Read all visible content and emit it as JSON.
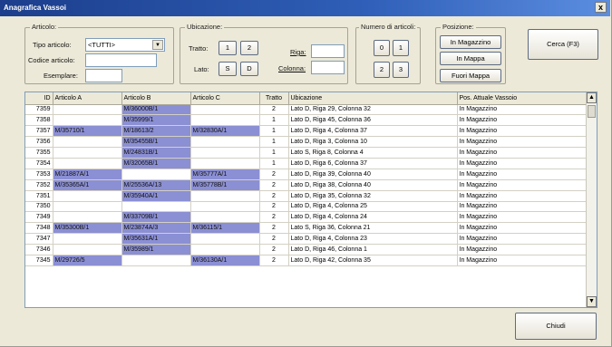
{
  "window": {
    "title": "Anagrafica Vassoi",
    "close": "x"
  },
  "articolo": {
    "title": "Articolo:",
    "tipo_label": "Tipo articolo:",
    "tipo_value": "<TUTTI>",
    "codice_label": "Codice articolo:",
    "codice_value": "",
    "esemplare_label": "Esemplare:",
    "esemplare_value": ""
  },
  "ubicazione": {
    "title": "Ubicazione:",
    "tratto_label": "Tratto:",
    "tratto_buttons": [
      "1",
      "2"
    ],
    "lato_label": "Lato:",
    "lato_buttons": [
      "S",
      "D"
    ],
    "riga_label": "Riga:",
    "riga_value": "",
    "colonna_label": "Colonna:",
    "colonna_value": ""
  },
  "numero": {
    "title": "Numero di articoli:",
    "buttons": [
      "0",
      "1",
      "2",
      "3"
    ]
  },
  "posizione": {
    "title": "Posizione:",
    "buttons": [
      "In Magazzino",
      "In Mappa",
      "Fuori Mappa"
    ]
  },
  "search_button": "Cerca (F3)",
  "close_button": "Chiudi",
  "table": {
    "headers": [
      "ID",
      "Articolo A",
      "Articolo B",
      "Articolo C",
      "Tratto",
      "Ubicazione",
      "Pos. Attuale Vassoio"
    ],
    "rows": [
      [
        "7359",
        "",
        "M/36000B/1",
        "",
        "2",
        "Lato D, Riga 29, Colonna 32",
        "In Magazzino"
      ],
      [
        "7358",
        "",
        "M/35999/1",
        "",
        "1",
        "Lato D, Riga 45, Colonna 36",
        "In Magazzino"
      ],
      [
        "7357",
        "M/35710/1",
        "M/18613/2",
        "M/32830A/1",
        "1",
        "Lato D, Riga 4, Colonna 37",
        "In Magazzino"
      ],
      [
        "7356",
        "",
        "M/35455B/1",
        "",
        "1",
        "Lato D, Riga 3, Colonna 10",
        "In Magazzino"
      ],
      [
        "7355",
        "",
        "M/24831B/1",
        "",
        "1",
        "Lato S, Riga 8, Colonna 4",
        "In Magazzino"
      ],
      [
        "7354",
        "",
        "M/32065B/1",
        "",
        "1",
        "Lato D, Riga 6, Colonna 37",
        "In Magazzino"
      ],
      [
        "7353",
        "M/21887A/1",
        "",
        "M/35777A/1",
        "2",
        "Lato D, Riga 39, Colonna 40",
        "In Magazzino"
      ],
      [
        "7352",
        "M/35365A/1",
        "M/25536A/13",
        "M/35778B/1",
        "2",
        "Lato D, Riga 38, Colonna 40",
        "In Magazzino"
      ],
      [
        "7351",
        "",
        "M/35940A/1",
        "",
        "2",
        "Lato D, Riga 35, Colonna 32",
        "In Magazzino"
      ],
      [
        "7350",
        "",
        "",
        "",
        "2",
        "Lato D, Riga 4, Colonna 25",
        "In Magazzino"
      ],
      [
        "7349",
        "",
        "M/33709B/1",
        "",
        "2",
        "Lato D, Riga 4, Colonna 24",
        "In Magazzino"
      ],
      [
        "7348",
        "M/35300B/1",
        "M/23874A/3",
        "M/36115/1",
        "2",
        "Lato S, Riga 36, Colonna 21",
        "In Magazzino"
      ],
      [
        "7347",
        "",
        "M/35631A/1",
        "",
        "2",
        "Lato D, Riga 4, Colonna 23",
        "In Magazzino"
      ],
      [
        "7346",
        "",
        "M/35989/1",
        "",
        "2",
        "Lato D, Riga 46, Colonna 1",
        "In Magazzino"
      ],
      [
        "7345",
        "M/29726/5",
        "",
        "M/36130A/1",
        "2",
        "Lato D, Riga 42, Colonna 35",
        "In Magazzino"
      ]
    ]
  },
  "colors": {
    "highlight": "#8b8fd3",
    "titlebar": "#2f5fb8",
    "window": "#ece9d8"
  }
}
